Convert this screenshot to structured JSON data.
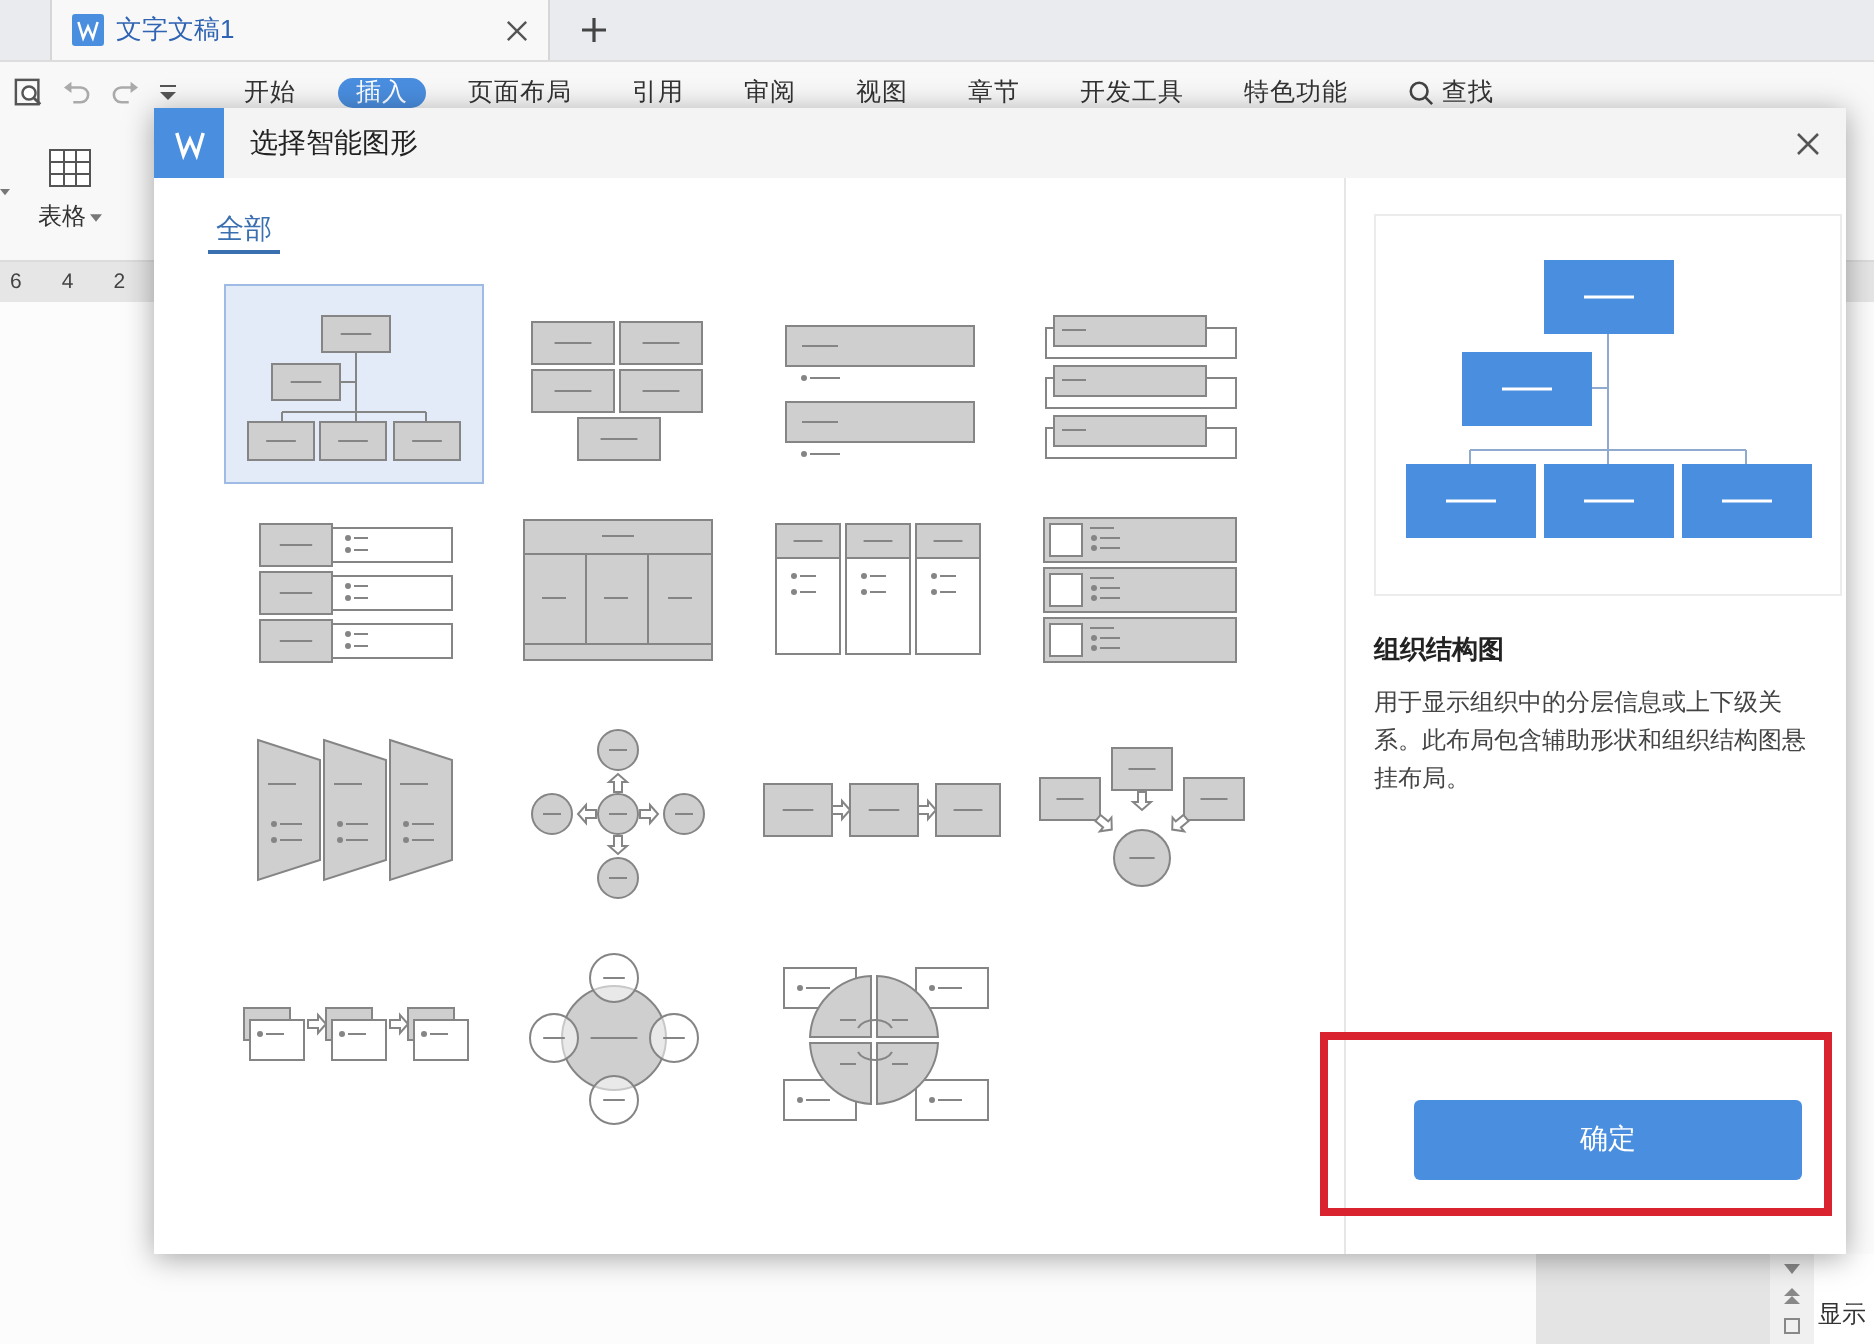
{
  "document_tab": {
    "title": "文字文稿1"
  },
  "menu": [
    {
      "label": "开始",
      "selected": false,
      "kind": "tab"
    },
    {
      "label": "插入",
      "selected": true,
      "kind": "tab"
    },
    {
      "label": "页面布局",
      "selected": false,
      "kind": "tab"
    },
    {
      "label": "引用",
      "selected": false,
      "kind": "tab"
    },
    {
      "label": "审阅",
      "selected": false,
      "kind": "tab"
    },
    {
      "label": "视图",
      "selected": false,
      "kind": "tab"
    },
    {
      "label": "章节",
      "selected": false,
      "kind": "tab"
    },
    {
      "label": "开发工具",
      "selected": false,
      "kind": "tab"
    },
    {
      "label": "特色功能",
      "selected": false,
      "kind": "tab"
    },
    {
      "label": "查找",
      "selected": false,
      "kind": "search"
    }
  ],
  "ribbon": [
    {
      "label": "表格",
      "kind": "table"
    }
  ],
  "ruler": [
    "6",
    "4",
    "2"
  ],
  "status": {
    "label": "显示"
  },
  "dialog": {
    "title": "选择智能图形",
    "tabs": [
      {
        "label": "全部",
        "selected": true
      }
    ],
    "layouts": [
      {
        "kind": "hierarchy",
        "selected": true
      },
      {
        "kind": "block-grid",
        "selected": false
      },
      {
        "kind": "bullet-bars",
        "selected": false
      },
      {
        "kind": "stacked-tabs",
        "selected": false
      },
      {
        "kind": "side-list",
        "selected": false
      },
      {
        "kind": "table-blocks",
        "selected": false
      },
      {
        "kind": "column-list",
        "selected": false
      },
      {
        "kind": "picture-rows",
        "selected": false
      },
      {
        "kind": "trapezoids",
        "selected": false
      },
      {
        "kind": "radial",
        "selected": false
      },
      {
        "kind": "process",
        "selected": false
      },
      {
        "kind": "converging",
        "selected": false
      },
      {
        "kind": "step-cards",
        "selected": false
      },
      {
        "kind": "cycle-circles",
        "selected": false
      },
      {
        "kind": "quadrant-cycle",
        "selected": false
      }
    ],
    "preview": {
      "title": "组织结构图",
      "description": "用于显示组织中的分层信息或上下级关系。此布局包含辅助形状和组织结构图悬挂布局。"
    },
    "confirm": "确定"
  }
}
